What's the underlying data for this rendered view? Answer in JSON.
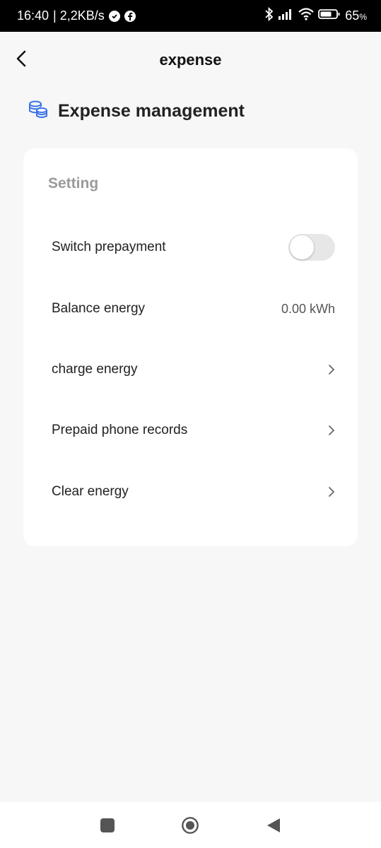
{
  "status_bar": {
    "time": "16:40",
    "speed": "| 2,2KB/s",
    "battery": "65",
    "battery_unit": "%"
  },
  "header": {
    "title": "expense"
  },
  "section": {
    "title": "Expense management",
    "icon": "coins-stack-icon",
    "icon_color": "#3b74e8"
  },
  "card": {
    "label": "Setting",
    "rows": [
      {
        "label": "Switch prepayment",
        "control": "toggle",
        "toggle_on": false
      },
      {
        "label": "Balance energy",
        "value": "0.00 kWh"
      },
      {
        "label": "charge energy",
        "control": "chevron"
      },
      {
        "label": "Prepaid phone records",
        "control": "chevron"
      },
      {
        "label": "Clear energy",
        "control": "chevron"
      }
    ]
  },
  "nav_bar": {
    "buttons": [
      "recents-square-icon",
      "home-circle-icon",
      "back-triangle-icon"
    ]
  }
}
